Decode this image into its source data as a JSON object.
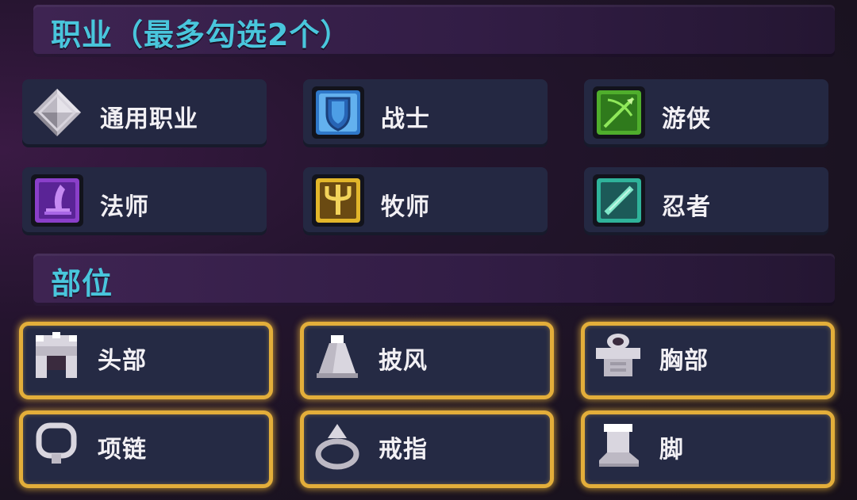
{
  "sections": {
    "class": {
      "title": "职业（最多勾选2个）",
      "items": [
        {
          "label": "通用职业",
          "icon": "gray-diamond-icon"
        },
        {
          "label": "战士",
          "icon": "blue-shield-icon"
        },
        {
          "label": "游侠",
          "icon": "green-bow-icon"
        },
        {
          "label": "法师",
          "icon": "purple-wizard-hat-icon"
        },
        {
          "label": "牧师",
          "icon": "yellow-staff-icon"
        },
        {
          "label": "忍者",
          "icon": "teal-blade-icon"
        }
      ]
    },
    "slot": {
      "title": "部位",
      "items": [
        {
          "label": "头部",
          "icon": "helmet-icon",
          "selected": true
        },
        {
          "label": "披风",
          "icon": "cloak-icon",
          "selected": true
        },
        {
          "label": "胸部",
          "icon": "chest-armor-icon",
          "selected": true
        },
        {
          "label": "项链",
          "icon": "necklace-icon",
          "selected": true
        },
        {
          "label": "戒指",
          "icon": "ring-icon",
          "selected": true
        },
        {
          "label": "脚",
          "icon": "boot-icon",
          "selected": true
        }
      ]
    }
  },
  "colors": {
    "header_text": "#49c6dc",
    "selected_border": "#e3ae3a",
    "card_bg": "#242842"
  }
}
